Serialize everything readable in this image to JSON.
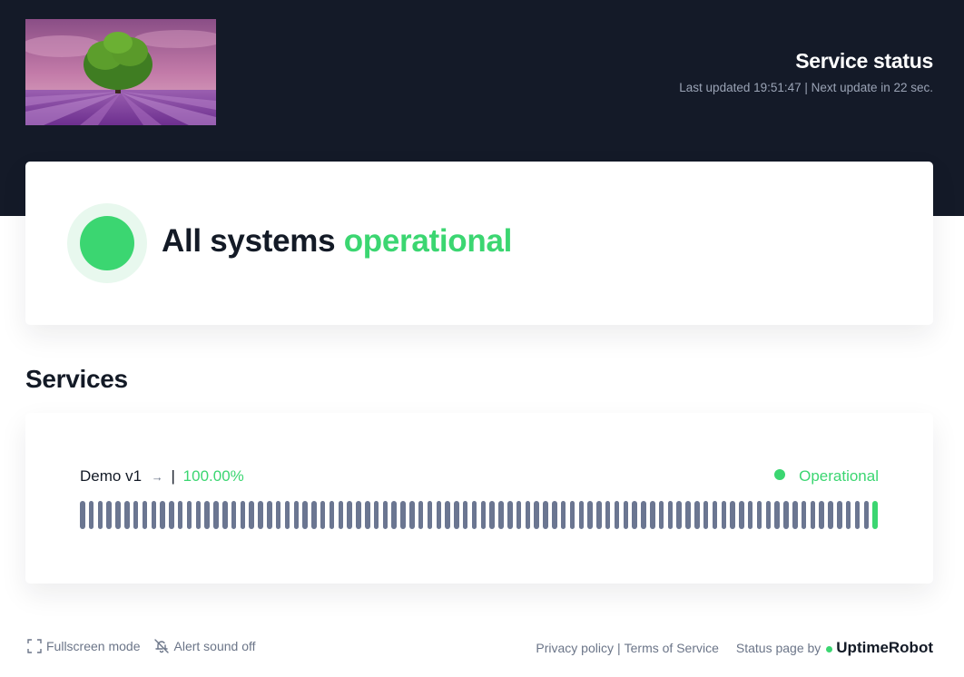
{
  "header": {
    "title": "Service status",
    "last_updated": "Last updated 19:51:47 | Next update in 22 sec."
  },
  "overall": {
    "prefix": "All systems",
    "status_word": "operational",
    "status_color": "#3bd671"
  },
  "services_section": {
    "title": "Services",
    "items": [
      {
        "name": "Demo v1",
        "arrow": "→",
        "separator": "|",
        "uptime": "100.00%",
        "status": "Operational",
        "status_color": "#3bd671",
        "bar_count": 90,
        "bar_color": "#6b7691",
        "last_bar_color": "#3bd671"
      }
    ]
  },
  "footer": {
    "fullscreen": "Fullscreen mode",
    "alert_sound": "Alert sound off",
    "privacy": "Privacy policy",
    "separator": "|",
    "terms": "Terms of Service",
    "powered_by": "Status page by",
    "brand": "UptimeRobot",
    "brand_dot_color": "#3bd671"
  },
  "icons": {
    "logo": "tree-lavender-field-logo",
    "fullscreen": "fullscreen-icon",
    "alert": "bell-off-icon",
    "arrow": "arrow-right-icon"
  }
}
